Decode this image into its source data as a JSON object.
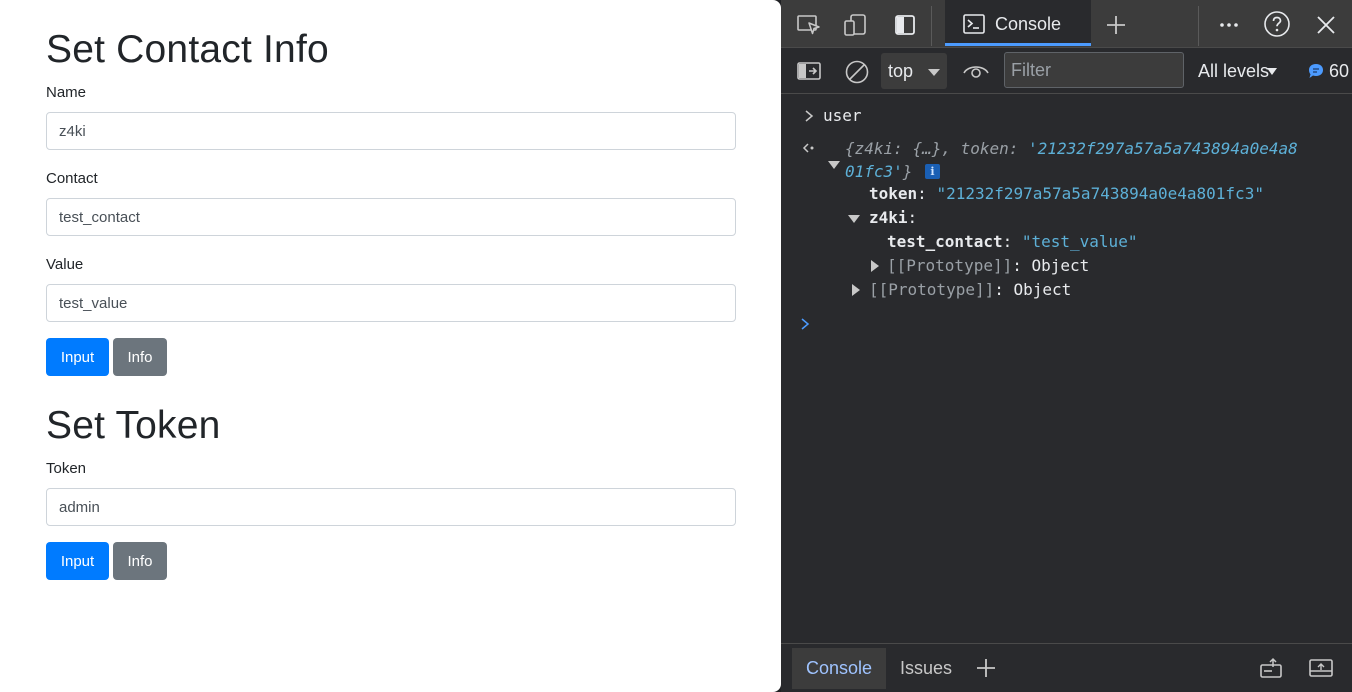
{
  "page": {
    "contact_section": {
      "title": "Set Contact Info",
      "name_label": "Name",
      "name_value": "z4ki",
      "contact_label": "Contact",
      "contact_value": "test_contact",
      "value_label": "Value",
      "value_value": "test_value",
      "input_button": "Input",
      "info_button": "Info"
    },
    "token_section": {
      "title": "Set Token",
      "token_label": "Token",
      "token_value": "admin",
      "input_button": "Input",
      "info_button": "Info"
    }
  },
  "devtools": {
    "tabs": {
      "console_label": "Console",
      "icons": [
        "inspect-icon",
        "device-emulation-icon",
        "dock-side-icon",
        "console-icon",
        "add-tab-icon",
        "more-icon",
        "help-icon",
        "close-icon"
      ]
    },
    "toolbar": {
      "context": "top",
      "filter_placeholder": "Filter",
      "levels": "All levels",
      "message_count": "60"
    },
    "console": {
      "input_command": "user",
      "preview_open": "{",
      "preview_key1": "z4ki",
      "preview_sep1": ": ",
      "preview_val1": "{…}",
      "preview_comma": ", ",
      "preview_key2": "token",
      "preview_sep2": ": ",
      "preview_val2_part1": "'21232f297a57a5a743894a0e4a8",
      "preview_val2_part2": "01fc3'",
      "preview_close": "}",
      "info_badge": "i",
      "token_key": "token",
      "token_value": "\"21232f297a57a5a743894a0e4a801fc3\"",
      "z4ki_key": "z4ki",
      "colon": ":",
      "contact_key": "test_contact",
      "contact_value": "\"test_value\"",
      "proto_label": "[[Prototype]]",
      "proto_value": "Object"
    },
    "drawer": {
      "console_tab": "Console",
      "issues_tab": "Issues"
    },
    "colors": {
      "accent": "#4c9bff",
      "primary_button": "#007bff",
      "secondary_button": "#6c757d",
      "string_value": "#5db0d7"
    }
  }
}
